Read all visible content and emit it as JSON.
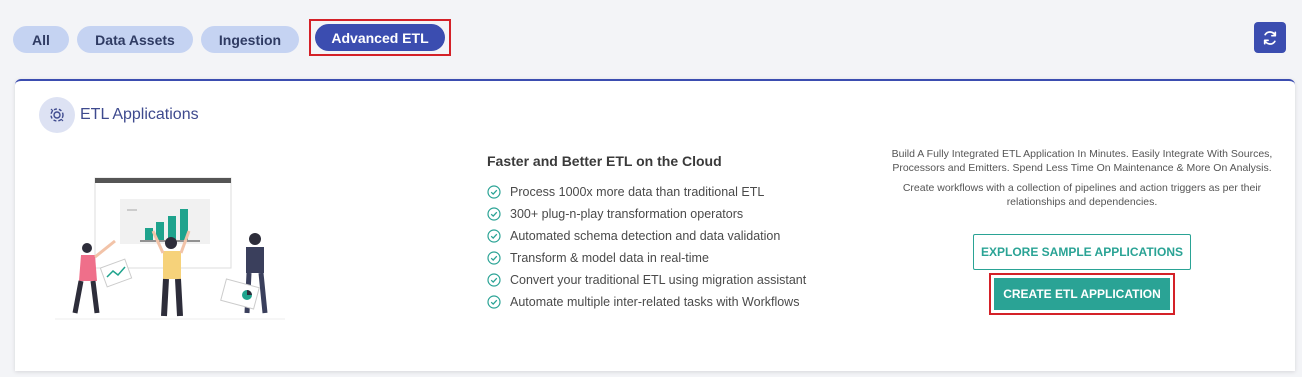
{
  "filters": {
    "all": "All",
    "data_assets": "Data Assets",
    "ingestion": "Ingestion",
    "advanced_etl": "Advanced ETL"
  },
  "card": {
    "title": "ETL Applications",
    "features_title": "Faster and Better ETL on the Cloud",
    "features": [
      "Process 1000x more data than traditional ETL",
      "300+ plug-n-play transformation operators",
      "Automated schema detection and data validation",
      "Transform & model data in real-time",
      "Convert your traditional ETL using migration assistant",
      "Automate multiple inter-related tasks with Workflows"
    ],
    "description_1": "Build A Fully Integrated ETL Application In Minutes. Easily Integrate With Sources, Processors and Emitters. Spend Less Time On Maintenance & More On Analysis.",
    "description_2": "Create workflows with a collection of pipelines and action triggers as per their relationships and dependencies.",
    "explore_label": "EXPLORE SAMPLE APPLICATIONS",
    "create_label": "CREATE ETL APPLICATION"
  },
  "colors": {
    "accent": "#3b4db0",
    "teal": "#2aa395",
    "highlight": "#d42128"
  }
}
